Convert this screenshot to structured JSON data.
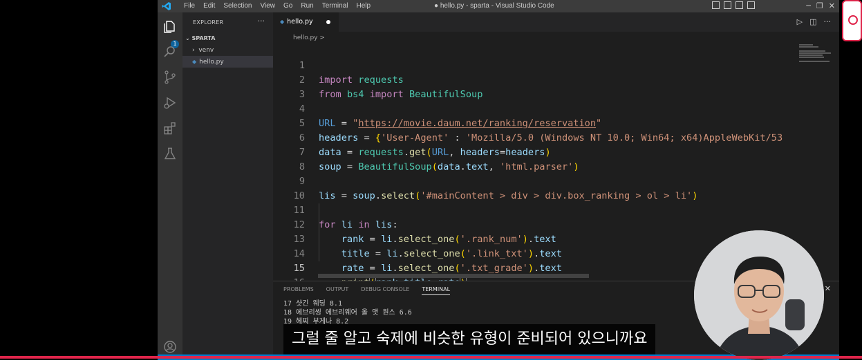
{
  "window": {
    "title": "● hello.py - sparta - Visual Studio Code",
    "menu": [
      "File",
      "Edit",
      "Selection",
      "View",
      "Go",
      "Run",
      "Terminal",
      "Help"
    ]
  },
  "activity_bar": {
    "items": [
      "files-icon",
      "search-icon",
      "source-control-icon",
      "run-debug-icon",
      "extensions-icon",
      "testing-icon",
      "account-icon"
    ],
    "badge": "1"
  },
  "sidebar": {
    "title": "EXPLORER",
    "more": "···",
    "folder": "SPARTA",
    "items": [
      {
        "label": "venv",
        "type": "folder"
      },
      {
        "label": "hello.py",
        "type": "file"
      }
    ]
  },
  "editor": {
    "tab_label": "hello.py",
    "breadcrumb": "hello.py >",
    "current_line": 15
  },
  "code_lines": [
    "import requests",
    "from bs4 import BeautifulSoup",
    "",
    "URL = \"https://movie.daum.net/ranking/reservation\"",
    "headers = {'User-Agent' : 'Mozilla/5.0 (Windows NT 10.0; Win64; x64)AppleWebKit/53",
    "data = requests.get(URL, headers=headers)",
    "soup = BeautifulSoup(data.text, 'html.parser')",
    "",
    "lis = soup.select('#mainContent > div > div.box_ranking > ol > li')",
    "",
    "for li in lis:",
    "    rank = li.select_one('.rank_num').text",
    "    title = li.select_one('.link_txt').text",
    "    rate = li.select_one('.txt_grade').text",
    "    print(rank,title,rate)",
    ""
  ],
  "panel": {
    "tabs": [
      "PROBLEMS",
      "OUTPUT",
      "DEBUG CONSOLE",
      "TERMINAL"
    ],
    "active_tab": "TERMINAL",
    "terminal_lines": [
      "17 샷긴 웨딩 8.1",
      "18 에브리씽 에브리웨어 올 앳 원스 6.6",
      "19 헤찌 부게나 8.2"
    ]
  },
  "overlay": {
    "subtitle": "그럴 줄 알고 숙제에 비슷한 유형이 준비되어 있으니까요"
  },
  "colors": {
    "accent": "#007acc",
    "progress": "#e0254b",
    "editor_bg": "#1e1e1e"
  }
}
